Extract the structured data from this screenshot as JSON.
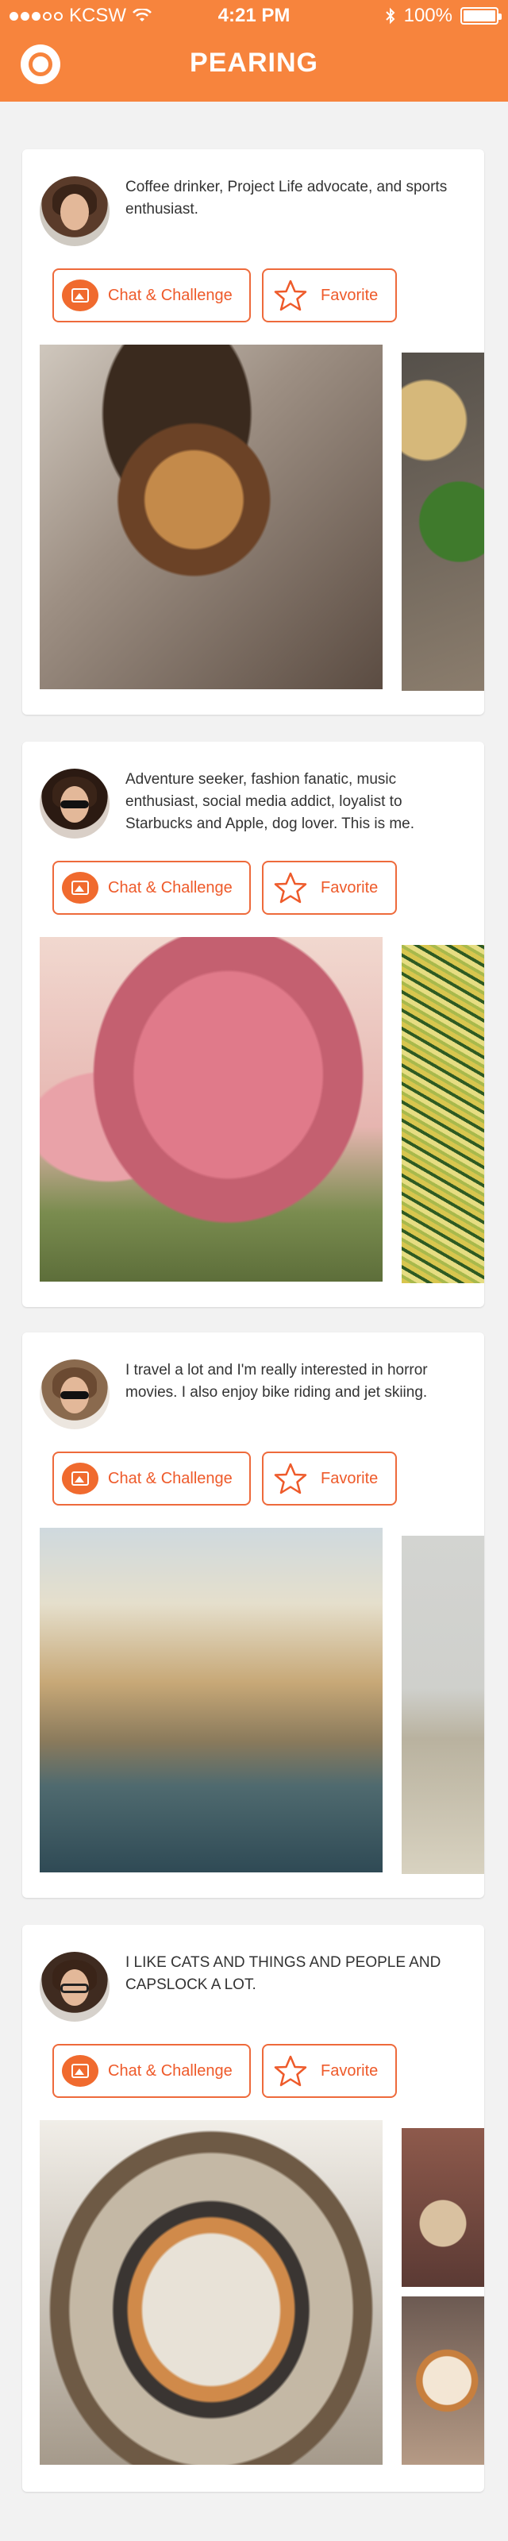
{
  "status_bar": {
    "carrier": "KCSW",
    "time": "4:21 PM",
    "battery": "100%"
  },
  "header": {
    "title": "PEARING"
  },
  "buttons": {
    "chat_label": "Chat & Challenge",
    "favorite_label": "Favorite"
  },
  "accent_color": "#f7843d",
  "button_color": "#ee5a2a",
  "profiles": [
    {
      "bio": "Coffee drinker, Project Life advocate, and sports enthusiast.",
      "photos": [
        "dog in sombrero",
        "food plate"
      ]
    },
    {
      "bio": "Adventure seeker, fashion fanatic, music enthusiast, social media addict, loyalist to Starbucks and Apple, dog lover. This is me.",
      "photos": [
        "pink autumn tree",
        "pizza"
      ]
    },
    {
      "bio": "I travel a lot and I'm really interested in horror movies. I also enjoy bike riding and jet skiing.",
      "photos": [
        "canal with boats",
        "cliff"
      ]
    },
    {
      "bio": "I LIKE CATS AND THINGS AND PEOPLE AND CAPSLOCK A LOT.",
      "photos": [
        "cat in bowl",
        "cat on blanket",
        "cat sleeping"
      ]
    }
  ]
}
